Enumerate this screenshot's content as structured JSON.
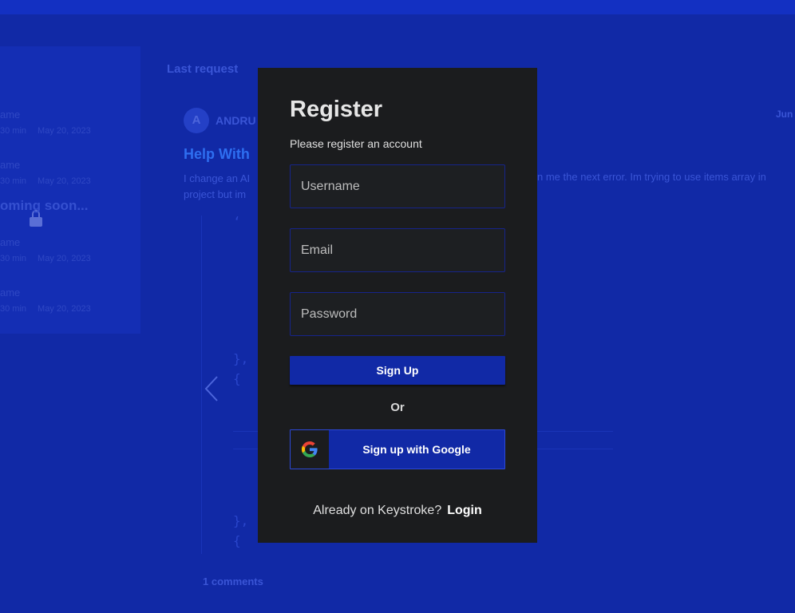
{
  "background": {
    "side_items": [
      {
        "name": "ame",
        "duration": "30 min",
        "date": "May 20, 2023"
      },
      {
        "name": "ame",
        "duration": "30 min",
        "date": "May 20, 2023"
      },
      {
        "name": "ame",
        "duration": "30 min",
        "date": "May 20, 2023"
      },
      {
        "name": "ame",
        "duration": "30 min",
        "date": "May 20, 2023"
      }
    ],
    "coming_soon": "oming soon...",
    "section_title": "Last request",
    "post": {
      "avatar_letter": "A",
      "author": "ANDRU",
      "date": "Jun",
      "title": "Help With",
      "text_left": "I change an AI",
      "text_right": "n me the next error. Im trying to use items array in",
      "text_line2": "project but im",
      "code_lines": [
        "‘",
        "},",
        "{",
        "},",
        "{"
      ],
      "comments": "1 comments"
    }
  },
  "modal": {
    "title": "Register",
    "subtitle": "Please register an account",
    "username_placeholder": "Username",
    "email_placeholder": "Email",
    "password_placeholder": "Password",
    "signup_label": "Sign Up",
    "or_label": "Or",
    "google_label": "Sign up with Google",
    "footer_prompt": "Already on Keystroke?",
    "login_label": "Login"
  },
  "colors": {
    "accent": "#1129a6",
    "modal_bg": "#1b1c1e"
  }
}
